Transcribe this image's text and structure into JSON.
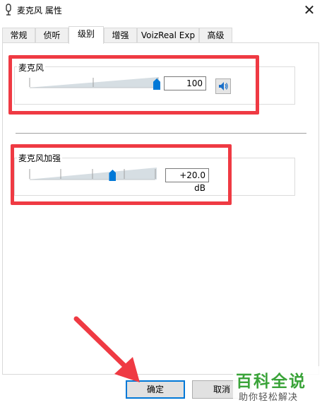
{
  "window": {
    "title": "麦克风 属性",
    "close_glyph": "✕"
  },
  "tabs": [
    {
      "label": "常规",
      "active": false
    },
    {
      "label": "侦听",
      "active": false
    },
    {
      "label": "级别",
      "active": true
    },
    {
      "label": "增强",
      "active": false
    },
    {
      "label": "VoizReal Exp",
      "active": false
    },
    {
      "label": "高级",
      "active": false
    }
  ],
  "microphone": {
    "label": "麦克风",
    "level_value": "100",
    "level_fraction": 1.0,
    "speaker_icon": "speaker-icon"
  },
  "boost": {
    "label": "麦克风加强",
    "value": "+20.0 dB",
    "level_fraction": 0.66
  },
  "buttons": {
    "ok": "确定",
    "cancel": "取消"
  },
  "watermark": {
    "title": "百科全说",
    "subtitle": "助你轻松解决"
  },
  "colors": {
    "accent": "#0078d7",
    "highlight_red": "#ef3a43",
    "arrow_red": "#ef3a43",
    "watermark_green": "#3aa339"
  }
}
